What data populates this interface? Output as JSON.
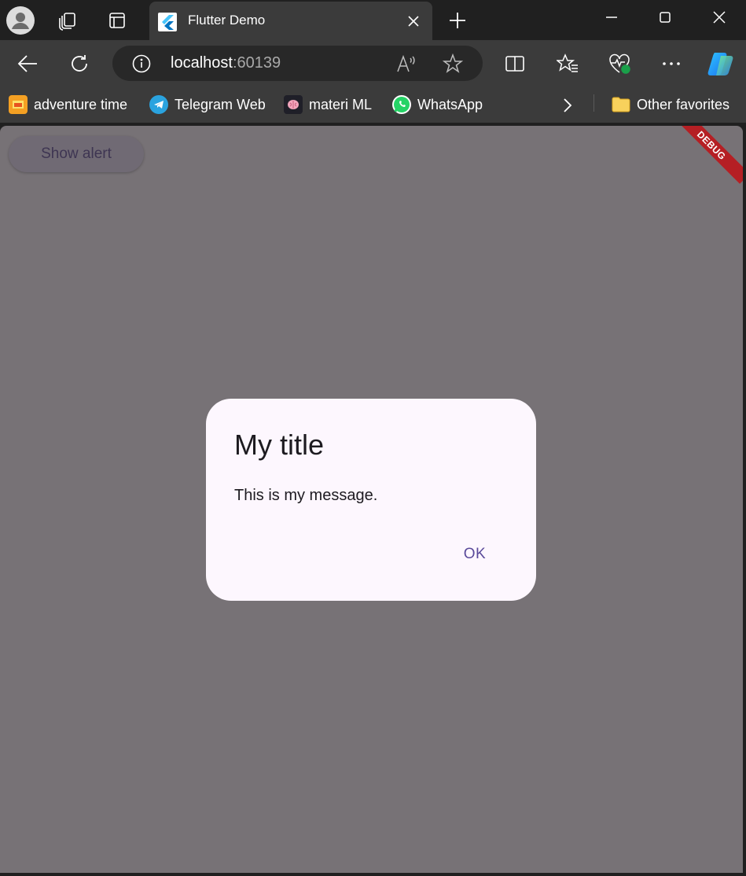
{
  "tab": {
    "title": "Flutter Demo",
    "favicon": "flutter-icon"
  },
  "address": {
    "host": "localhost",
    "port": ":60139"
  },
  "bookmarks": [
    {
      "label": "adventure time",
      "icon": "adventure-time-icon"
    },
    {
      "label": "Telegram Web",
      "icon": "telegram-icon"
    },
    {
      "label": "materi ML",
      "icon": "brain-icon"
    },
    {
      "label": "WhatsApp",
      "icon": "whatsapp-icon"
    }
  ],
  "other_favorites": "Other favorites",
  "page": {
    "show_alert_label": "Show alert",
    "debug_banner": "DEBUG"
  },
  "dialog": {
    "title": "My title",
    "message": "This is my message.",
    "ok_label": "OK"
  },
  "colors": {
    "chrome_dark": "#202020",
    "chrome": "#3b3b3b",
    "scrim": "#777276",
    "dialog_bg": "#fdf7fe",
    "accent": "#5a4a9a",
    "debug": "#b51f24"
  }
}
